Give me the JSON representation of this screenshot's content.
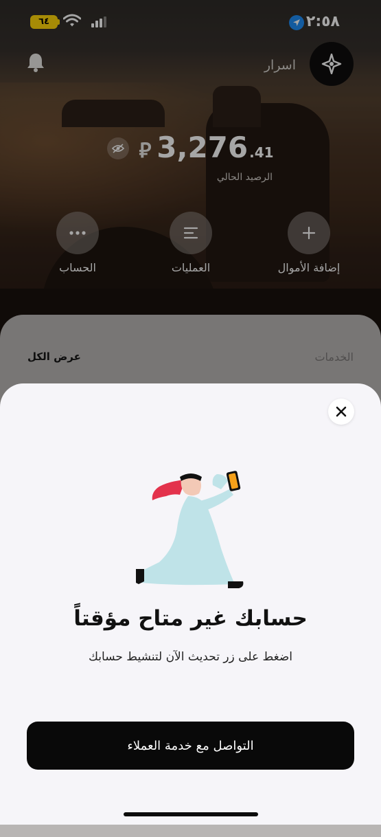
{
  "status_bar": {
    "time": "٢:٥٨",
    "battery": "٦٤"
  },
  "header": {
    "profile_name": "اسرار"
  },
  "balance": {
    "currency_symbol": "⃁",
    "amount": "3,276",
    "decimals": ".41",
    "label": "الرصيد الحالي"
  },
  "actions": [
    {
      "label": "إضافة الأموال",
      "icon": "plus-icon"
    },
    {
      "label": "العمليات",
      "icon": "list-icon"
    },
    {
      "label": "الحساب",
      "icon": "more-icon"
    }
  ],
  "services": {
    "title": "الخدمات",
    "view_all": "عرض الكل"
  },
  "modal": {
    "title": "حسابك غير متاح مؤقتاً",
    "subtitle": "اضغط على زر تحديث الآن لتنشيط حسابك",
    "cta": "التواصل مع خدمة العملاء"
  },
  "colors": {
    "accent": "#1e8df5",
    "battery": "#ffd60a",
    "cta_bg": "#090909",
    "modal_bg": "#f6f5f9"
  }
}
